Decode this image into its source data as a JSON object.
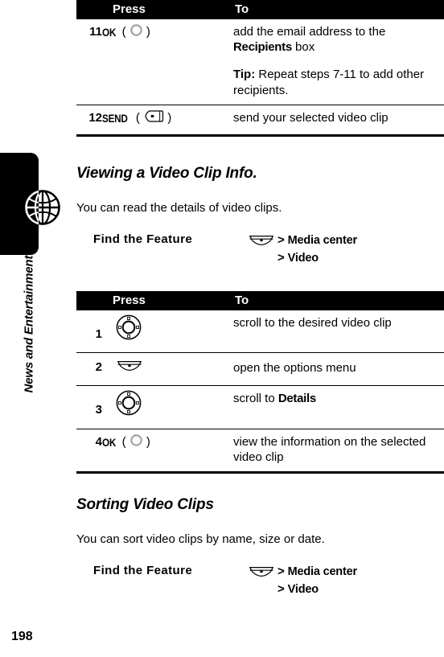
{
  "sidebar": {
    "chapter_title": "News and Entertainment",
    "page_number": "198",
    "globe_icon": "globe-icon"
  },
  "tables": [
    {
      "name": "send-video-clip-steps",
      "headers": {
        "num": "",
        "press": "Press",
        "to": "To"
      },
      "rows": [
        {
          "num": "11",
          "key_label": "OK",
          "key_icon": "ok-key-icon",
          "paragraphs": [
            {
              "parts": [
                {
                  "text": "add the email address to the ",
                  "style": "normal"
                },
                {
                  "text": "Recipients",
                  "style": "uiterm"
                },
                {
                  "text": " box",
                  "style": "normal"
                }
              ]
            },
            {
              "parts": [
                {
                  "text": "Tip:",
                  "style": "bold"
                },
                {
                  "text": " Repeat steps 7-11 to add other recipients.",
                  "style": "normal"
                }
              ]
            }
          ]
        },
        {
          "num": "12",
          "key_label": "SEND",
          "key_icon": "send-key-icon",
          "paragraphs": [
            {
              "parts": [
                {
                  "text": "send your selected video clip",
                  "style": "normal"
                }
              ]
            }
          ]
        }
      ]
    },
    {
      "name": "view-video-clip-info-steps",
      "headers": {
        "num": "",
        "press": "Press",
        "to": "To"
      },
      "rows": [
        {
          "num": "1",
          "key_label": "",
          "key_icon": "nav-wheel-icon",
          "paragraphs": [
            {
              "parts": [
                {
                  "text": "scroll to the desired video clip",
                  "style": "normal"
                }
              ]
            }
          ]
        },
        {
          "num": "2",
          "key_label": "",
          "key_icon": "menu-key-icon",
          "paragraphs": [
            {
              "parts": [
                {
                  "text": "open the options menu",
                  "style": "normal"
                }
              ]
            }
          ]
        },
        {
          "num": "3",
          "key_label": "",
          "key_icon": "nav-wheel-icon",
          "paragraphs": [
            {
              "parts": [
                {
                  "text": "scroll to ",
                  "style": "normal"
                },
                {
                  "text": "Details",
                  "style": "uiterm"
                }
              ]
            }
          ]
        },
        {
          "num": "4",
          "key_label": "OK",
          "key_icon": "ok-key-icon",
          "paragraphs": [
            {
              "parts": [
                {
                  "text": "view the information on the selected video clip",
                  "style": "normal"
                }
              ]
            }
          ]
        }
      ]
    }
  ],
  "sections": [
    {
      "heading": "Viewing a Video Clip Info.",
      "body": "You can read the details of video clips.",
      "find_the_feature": {
        "label": "Find the Feature",
        "menu_icon": "menu-key-icon",
        "path": [
          {
            "arrow": ">",
            "crumb": "Media center"
          },
          {
            "arrow": ">",
            "crumb": "Video"
          }
        ]
      }
    },
    {
      "heading": "Sorting Video Clips",
      "body": "You can sort video clips by name, size or date.",
      "find_the_feature": {
        "label": "Find the Feature",
        "menu_icon": "menu-key-icon",
        "path": [
          {
            "arrow": ">",
            "crumb": "Media center"
          },
          {
            "arrow": ">",
            "crumb": "Video"
          }
        ]
      }
    }
  ],
  "colors": {
    "ink": "#000000",
    "paper": "#ffffff",
    "header_bar": "#000000",
    "header_text": "#ffffff"
  }
}
